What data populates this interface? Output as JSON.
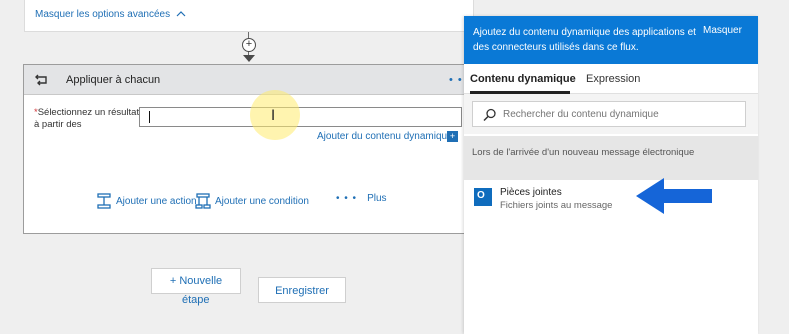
{
  "top_card": {
    "advanced_link": "Masquer les options avancées"
  },
  "card": {
    "title": "Appliquer à chacun",
    "dots": "• • •",
    "required_star": "*",
    "select_label": "Sélectionnez un résultat à partir des",
    "input_value": "",
    "dynamic_link": "Ajouter du contenu dynamique",
    "dynamic_plus": "+",
    "actions": {
      "add_action": "Ajouter une action",
      "add_condition": "Ajouter une condition",
      "more": "Plus",
      "more_dots": "• • •"
    }
  },
  "buttons": {
    "new_step_line1": "+ Nouvelle",
    "new_step_line2": "étape",
    "save": "Enregistrer"
  },
  "panel": {
    "description": "Ajoutez du contenu dynamique des applications et des connecteurs utilisés dans ce flux.",
    "hide": "Masquer",
    "tabs": [
      "Contenu dynamique",
      "Expression"
    ],
    "search_placeholder": "Rechercher du contenu dynamique",
    "section_header": "Lors de l'arrivée d'un nouveau message électronique",
    "item": {
      "title": "Pièces jointes",
      "subtitle": "Fichiers joints au message",
      "icon_letter": "O"
    }
  },
  "colors": {
    "accent": "#0a79d6",
    "link": "#1f6fb5",
    "annotation_arrow": "#1565d8",
    "cursor_highlight": "#ffeb6e"
  }
}
